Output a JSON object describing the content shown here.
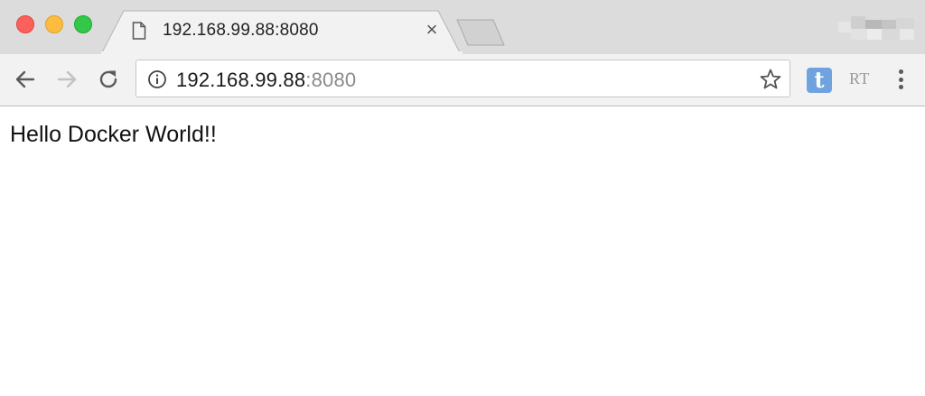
{
  "window": {
    "tab": {
      "title": "192.168.99.88:8080",
      "close_glyph": "×",
      "icon": "document-icon"
    }
  },
  "toolbar": {
    "url_host": "192.168.99.88",
    "url_port": ":8080",
    "extensions": {
      "t_label": "t",
      "rt_label": "RT"
    },
    "icons": [
      "back-arrow-icon",
      "forward-arrow-icon",
      "reload-icon",
      "info-icon",
      "star-icon",
      "menu-icon"
    ]
  },
  "page": {
    "body_text": "Hello Docker World!!"
  },
  "colors": {
    "close": "#fc605c",
    "minimize": "#fdbc40",
    "maximize": "#34c84a",
    "extension_t": "#6fa3df"
  }
}
